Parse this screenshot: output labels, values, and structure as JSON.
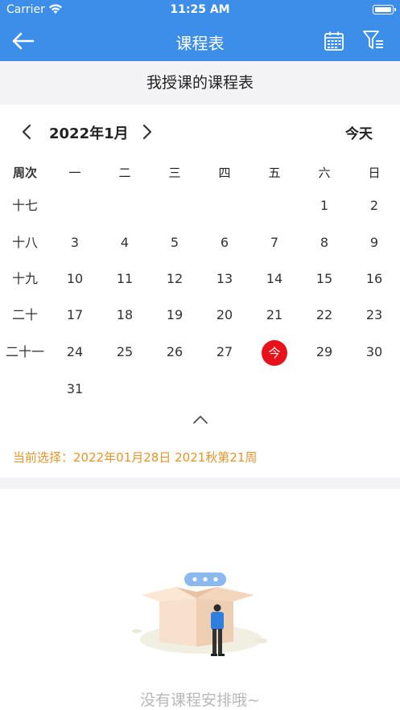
{
  "status_bar": {
    "carrier": "Carrier",
    "time": "11:25 AM"
  },
  "nav": {
    "title": "课程表",
    "back_icon": "back-arrow-icon",
    "calendar_icon": "calendar-icon",
    "filter_icon": "filter-icon"
  },
  "subheader": {
    "title": "我授课的课程表"
  },
  "calendar": {
    "month_label": "2022年1月",
    "today_button": "今天",
    "headers": [
      "周次",
      "一",
      "二",
      "三",
      "四",
      "五",
      "六",
      "日"
    ],
    "weeks": [
      {
        "week": "十七",
        "days": [
          "",
          "",
          "",
          "",
          "",
          "1",
          "2"
        ]
      },
      {
        "week": "十八",
        "days": [
          "3",
          "4",
          "5",
          "6",
          "7",
          "8",
          "9"
        ]
      },
      {
        "week": "十九",
        "days": [
          "10",
          "11",
          "12",
          "13",
          "14",
          "15",
          "16"
        ]
      },
      {
        "week": "二十",
        "days": [
          "17",
          "18",
          "19",
          "20",
          "21",
          "22",
          "23"
        ]
      },
      {
        "week": "二十一",
        "days": [
          "24",
          "25",
          "26",
          "27",
          "今",
          "29",
          "30"
        ]
      },
      {
        "week": "",
        "days": [
          "31",
          "",
          "",
          "",
          "",
          "",
          ""
        ]
      }
    ],
    "today_marker": "今",
    "today_color": "#e8101a"
  },
  "selection": {
    "text": "当前选择：2022年01月28日 2021秋第21周"
  },
  "empty_state": {
    "text": "没有课程安排哦~",
    "illustration": "empty-box-illustration"
  },
  "colors": {
    "primary": "#3d8ee8",
    "accent": "#e0962e",
    "today": "#e8101a"
  }
}
